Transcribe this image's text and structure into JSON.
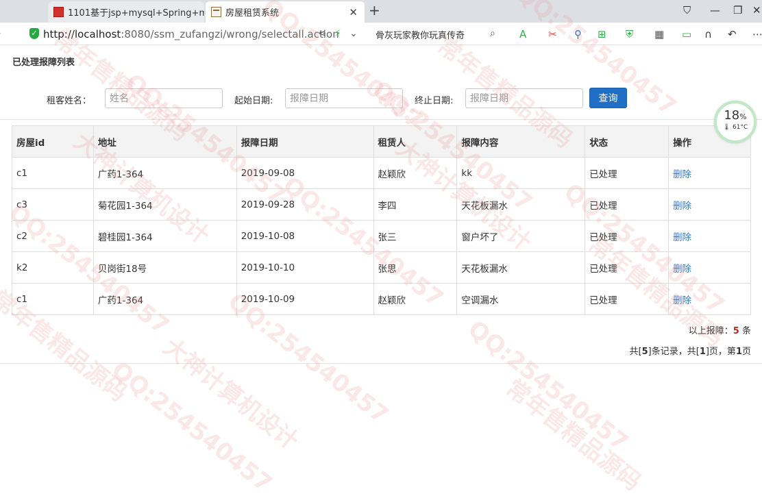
{
  "browser": {
    "tabs": [
      {
        "title": "1101基于jsp+mysql+Spring+m"
      },
      {
        "title": "房屋租赁系统"
      }
    ],
    "url_host": "http://localhost",
    "url_path": ":8080/ssm_zufangzi/wrong/selectall.action",
    "search_hint": "骨灰玩家教你玩真传奇"
  },
  "page": {
    "title": "已处理报障列表",
    "filters": {
      "name_label": "租客姓名：",
      "name_placeholder": "姓名",
      "start_label": "起始日期:",
      "start_placeholder": "报障日期",
      "end_label": "终止日期:",
      "end_placeholder": "报障日期",
      "query_label": "查询"
    },
    "table": {
      "headers": [
        "房屋id",
        "地址",
        "报障日期",
        "租赁人",
        "报障内容",
        "状态",
        "操作"
      ],
      "rows": [
        [
          "c1",
          "广药1-364",
          "2019-09-08",
          "赵颖欣",
          "kk",
          "已处理",
          "删除"
        ],
        [
          "c3",
          "菊花园1-364",
          "2019-09-28",
          "李四",
          "天花板漏水",
          "已处理",
          "删除"
        ],
        [
          "c2",
          "碧桂园1-364",
          "2019-10-08",
          "张三",
          "窗户坏了",
          "已处理",
          "删除"
        ],
        [
          "k2",
          "贝岗街18号",
          "2019-10-10",
          "张思",
          "天花板漏水",
          "已处理",
          "删除"
        ],
        [
          "c1",
          "广药1-364",
          "2019-10-09",
          "赵颖欣",
          "空调漏水",
          "已处理",
          "删除"
        ]
      ]
    },
    "summary": {
      "prefix": "以上报障：",
      "count": "5",
      "suffix": "条"
    },
    "pager": {
      "p1": "共[",
      "records": "5",
      "p2": "]条记录，共[",
      "pages": "1",
      "p3": "]页，第",
      "current": "1",
      "p4": "页"
    }
  },
  "widget": {
    "cpu_percent": "18",
    "cpu_unit": "%",
    "temperature": "61°C"
  },
  "watermarks": [
    "QQ:254540457",
    "大神计算机设计",
    "常年售精品源码"
  ]
}
